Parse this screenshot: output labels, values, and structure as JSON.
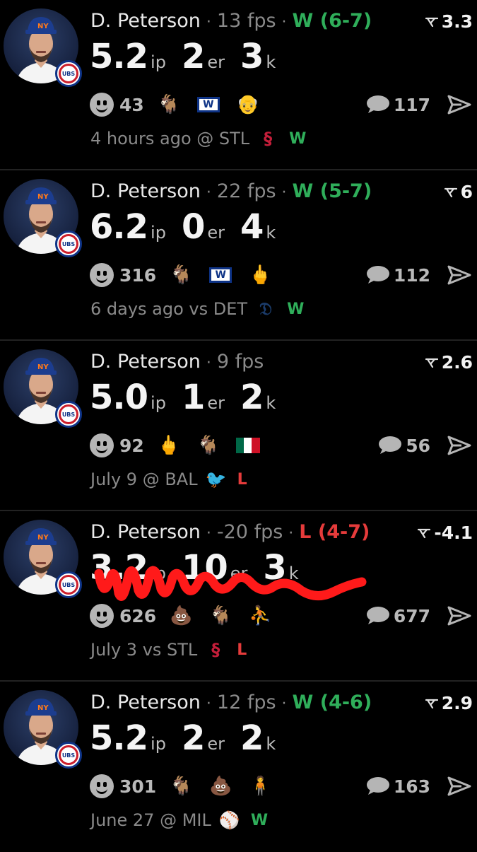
{
  "feed": [
    {
      "name": "D. Peterson",
      "fps": "13 fps",
      "decision": "W (6-7)",
      "decision_type": "W",
      "rating": "3.3",
      "ip": "5.2",
      "ip_unit": "ip",
      "er": "2",
      "er_unit": "er",
      "k": "3",
      "k_unit": "k",
      "smile_count": "43",
      "emojis": [
        "goat",
        "cubs-w-flag",
        "old-man"
      ],
      "comments": "117",
      "when": "4 hours ago @ STL",
      "opp_logo": "STL",
      "opp_color": "#c41e3a",
      "result": "W",
      "result_color": "#2fae5a"
    },
    {
      "name": "D. Peterson",
      "fps": "22 fps",
      "decision": "W (5-7)",
      "decision_type": "W",
      "rating": "6",
      "ip": "6.2",
      "ip_unit": "ip",
      "er": "0",
      "er_unit": "er",
      "k": "4",
      "k_unit": "k",
      "smile_count": "316",
      "emojis": [
        "goat",
        "cubs-w-flag",
        "middle-finger"
      ],
      "comments": "112",
      "when": "6 days ago vs DET",
      "opp_logo": "D",
      "opp_color": "#1b3c6b",
      "result": "W",
      "result_color": "#2fae5a"
    },
    {
      "name": "D. Peterson",
      "fps": "9 fps",
      "decision": "",
      "decision_type": "",
      "rating": "2.6",
      "ip": "5.0",
      "ip_unit": "ip",
      "er": "1",
      "er_unit": "er",
      "k": "2",
      "k_unit": "k",
      "smile_count": "92",
      "emojis": [
        "middle-finger",
        "goat",
        "mexico-flag"
      ],
      "comments": "56",
      "when": "July 9 @ BAL",
      "opp_logo": "BAL",
      "opp_color": "#df4601",
      "result": "L",
      "result_color": "#e53b3b"
    },
    {
      "name": "D. Peterson",
      "fps": "-20 fps",
      "decision": "L (4-7)",
      "decision_type": "L",
      "rating": "-4.1",
      "ip": "3.2",
      "ip_unit": "ip",
      "er": "10",
      "er_unit": "er",
      "k": "3",
      "k_unit": "k",
      "scribbled": true,
      "smile_count": "626",
      "emojis": [
        "poop",
        "goat",
        "lakers-player"
      ],
      "comments": "677",
      "when": "July 3 vs STL",
      "opp_logo": "STL",
      "opp_color": "#c41e3a",
      "result": "L",
      "result_color": "#e53b3b"
    },
    {
      "name": "D. Peterson",
      "fps": "12 fps",
      "decision": "W (4-6)",
      "decision_type": "W",
      "rating": "2.9",
      "ip": "5.2",
      "ip_unit": "ip",
      "er": "2",
      "er_unit": "er",
      "k": "2",
      "k_unit": "k",
      "smile_count": "301",
      "emojis": [
        "goat",
        "poop",
        "red-figure"
      ],
      "comments": "163",
      "when": "June 27 @ MIL",
      "opp_logo": "MIL",
      "opp_color": "#ffc52f",
      "result": "W",
      "result_color": "#2fae5a"
    }
  ],
  "colors": {
    "win": "#2fae5a",
    "loss": "#e53b3b",
    "muted": "#8a8a8a",
    "background": "#000000"
  },
  "icons": {
    "rating": "pitch-trajectory-icon",
    "reaction": "smile-face-icon",
    "comment": "speech-bubble-icon",
    "share": "send-arrow-icon"
  }
}
